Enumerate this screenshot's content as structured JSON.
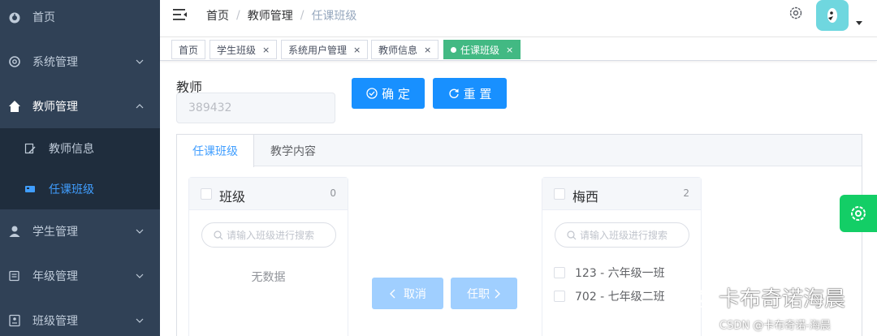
{
  "sidebar": {
    "items": [
      {
        "label": "首页",
        "icon": "dashboard-icon"
      },
      {
        "label": "系统管理",
        "icon": "gear-icon"
      },
      {
        "label": "教师管理",
        "icon": "home-icon"
      },
      {
        "label": "学生管理",
        "icon": "user-icon"
      },
      {
        "label": "年级管理",
        "icon": "list-icon"
      },
      {
        "label": "班级管理",
        "icon": "form-icon"
      }
    ],
    "subitems": [
      {
        "label": "教师信息",
        "icon": "edit-doc-icon"
      },
      {
        "label": "任课班级",
        "icon": "card-icon"
      }
    ]
  },
  "header": {
    "breadcrumb": [
      "首页",
      "教师管理",
      "任课班级"
    ]
  },
  "tags": [
    {
      "label": "首页"
    },
    {
      "label": "学生班级"
    },
    {
      "label": "系统用户管理"
    },
    {
      "label": "教师信息"
    },
    {
      "label": "任课班级"
    }
  ],
  "form": {
    "label": "教师",
    "teacher_value": "389432",
    "confirm_label": "确 定",
    "reset_label": "重 置"
  },
  "tabs": [
    "任课班级",
    "教学内容"
  ],
  "transfer": {
    "left": {
      "title": "班级",
      "count": "0",
      "search_placeholder": "请输入班级进行搜索",
      "empty_text": "无数据"
    },
    "right": {
      "title": "梅西",
      "count": "2",
      "search_placeholder": "请输入班级进行搜索",
      "items": [
        "123 - 六年级一班",
        "702 - 七年级二班"
      ]
    },
    "to_left_label": "取消",
    "to_right_label": "任职"
  },
  "colors": {
    "sidebar_bg": "#304156",
    "submenu_bg": "#1f2d3d",
    "primary": "#1890ff",
    "active_tag": "#42b983",
    "float_settings": "#13ce66"
  },
  "watermark": {
    "text": "卡布奇诺海晨",
    "csdn": "CSDN @卡布奇诺-海晨"
  }
}
